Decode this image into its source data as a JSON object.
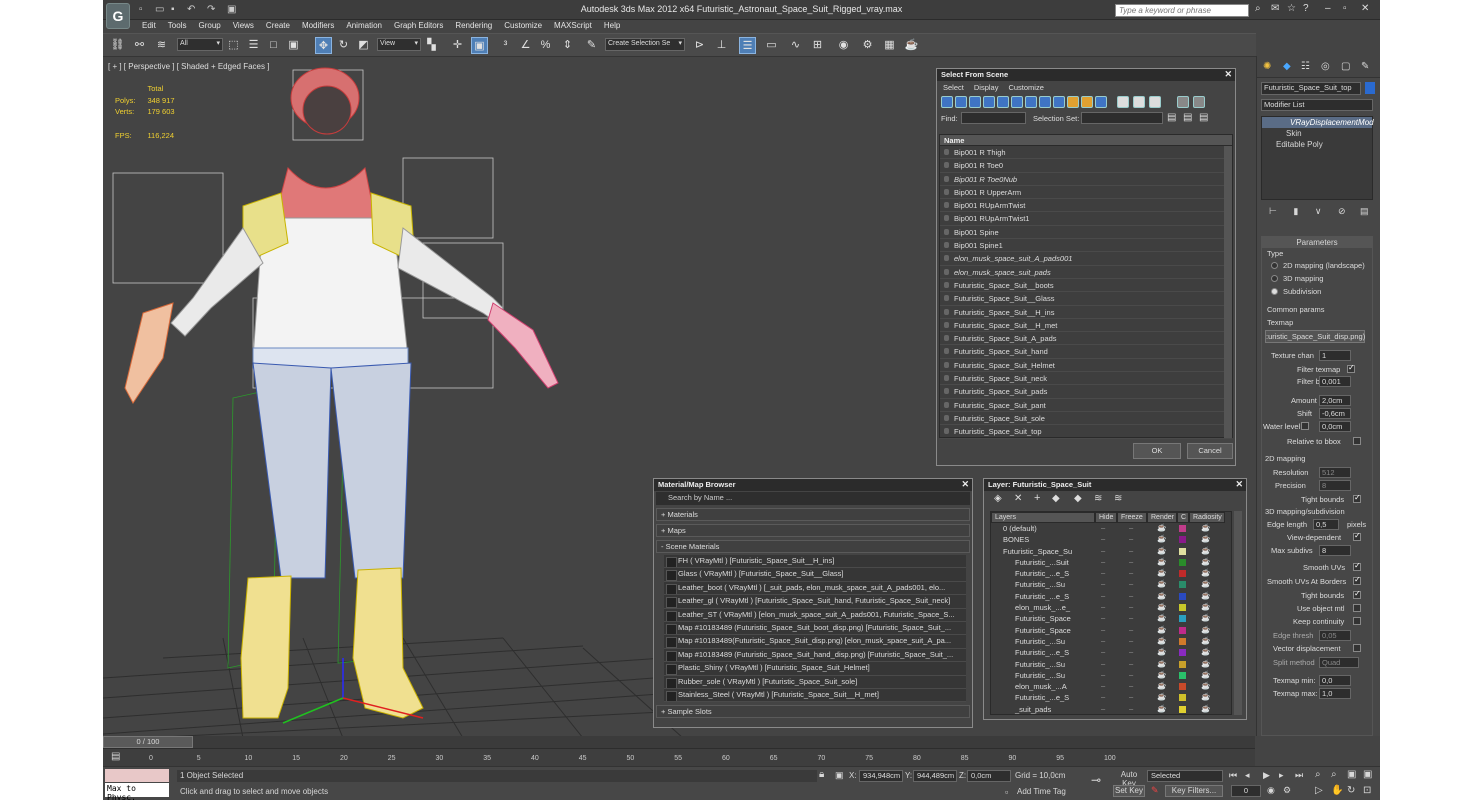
{
  "title": "Autodesk 3ds Max  2012 x64      Futuristic_Astronaut_Space_Suit_Rigged_vray.max",
  "search_placeholder": "Type a keyword or phrase",
  "menu": [
    "Edit",
    "Tools",
    "Group",
    "Views",
    "Create",
    "Modifiers",
    "Animation",
    "Graph Editors",
    "Rendering",
    "Customize",
    "MAXScript",
    "Help"
  ],
  "toolbar": {
    "filter": "All",
    "ref_coord": "View",
    "selection_set": "Create Selection Se"
  },
  "viewport": {
    "label": "[ + ] [ Perspective ] [ Shaded + Edged Faces ]",
    "stats": {
      "total_label": "Total",
      "polys_label": "Polys:",
      "polys": "348 917",
      "verts_label": "Verts:",
      "verts": "179 603",
      "fps_label": "FPS:",
      "fps": "116,224"
    }
  },
  "select_from_scene": {
    "title": "Select From Scene",
    "menu": [
      "Select",
      "Display",
      "Customize"
    ],
    "find_label": "Find:",
    "selection_set_label": "Selection Set:",
    "column": "Name",
    "rows": [
      {
        "name": "Bip001 R Thigh",
        "italic": false
      },
      {
        "name": "Bip001 R Toe0",
        "italic": false
      },
      {
        "name": "Bip001 R Toe0Nub",
        "italic": true
      },
      {
        "name": "Bip001 R UpperArm",
        "italic": false
      },
      {
        "name": "Bip001 RUpArmTwist",
        "italic": false
      },
      {
        "name": "Bip001 RUpArmTwist1",
        "italic": false
      },
      {
        "name": "Bip001 Spine",
        "italic": false
      },
      {
        "name": "Bip001 Spine1",
        "italic": false
      },
      {
        "name": "elon_musk_space_suit_A_pads001",
        "italic": true
      },
      {
        "name": "elon_musk_space_suit_pads",
        "italic": true
      },
      {
        "name": "Futuristic_Space_Suit__boots",
        "italic": false
      },
      {
        "name": "Futuristic_Space_Suit__Glass",
        "italic": false
      },
      {
        "name": "Futuristic_Space_Suit__H_ins",
        "italic": false
      },
      {
        "name": "Futuristic_Space_Suit__H_met",
        "italic": false
      },
      {
        "name": "Futuristic_Space_Suit_A_pads",
        "italic": false
      },
      {
        "name": "Futuristic_Space_Suit_hand",
        "italic": false
      },
      {
        "name": "Futuristic_Space_Suit_Helmet",
        "italic": false
      },
      {
        "name": "Futuristic_Space_Suit_neck",
        "italic": false
      },
      {
        "name": "Futuristic_Space_Suit_pads",
        "italic": false
      },
      {
        "name": "Futuristic_Space_Suit_pant",
        "italic": false
      },
      {
        "name": "Futuristic_Space_Suit_sole",
        "italic": false
      },
      {
        "name": "Futuristic_Space_Suit_top",
        "italic": false
      }
    ],
    "ok": "OK",
    "cancel": "Cancel"
  },
  "material_browser": {
    "title": "Material/Map Browser",
    "search": "Search by Name ...",
    "sections": {
      "materials": "+ Materials",
      "maps": "+ Maps",
      "scene": "- Scene Materials",
      "slots": "+ Sample Slots"
    },
    "items": [
      "FH  ( VRayMtl ) [Futuristic_Space_Suit__H_ins]",
      "Glass  ( VRayMtl ) [Futuristic_Space_Suit__Glass]",
      "Leather_boot  ( VRayMtl ) [_suit_pads, elon_musk_space_suit_A_pads001, elo...",
      "Leather_gl  ( VRayMtl ) [Futuristic_Space_Suit_hand, Futuristic_Space_Suit_neck]",
      "Leather_ST  ( VRayMtl ) [elon_musk_space_suit_A_pads001, Futuristic_Space_S...",
      "Map #10183489 (Futuristic_Space_Suit_boot_disp.png) [Futuristic_Space_Suit_...",
      "Map #10183489(Futuristic_Space_Suit_disp.png) [elon_musk_space_suit_A_pa...",
      "Map #10183489 (Futuristic_Space_Suit_hand_disp.png) [Futuristic_Space_Suit_...",
      "Plastic_Shiny  ( VRayMtl ) [Futuristic_Space_Suit_Helmet]",
      "Rubber_sole  ( VRayMtl ) [Futuristic_Space_Suit_sole]",
      "Stainless_Steel  ( VRayMtl ) [Futuristic_Space_Suit__H_met]"
    ]
  },
  "layer_panel": {
    "title": "Layer: Futuristic_Space_Suit",
    "headers": [
      "Layers",
      "Hide",
      "Freeze",
      "Render",
      "C",
      "Radiosity"
    ],
    "rows": [
      {
        "name": "0 (default)",
        "indent": 0,
        "color": "#c03c8a"
      },
      {
        "name": "BONES",
        "indent": 0,
        "color": "#8a1a8a"
      },
      {
        "name": "Futuristic_Space_Su",
        "indent": 0,
        "color": "#e0e0a0"
      },
      {
        "name": "Futuristic_...Suit",
        "indent": 1,
        "color": "#2a8c2a"
      },
      {
        "name": "Futuristic_...e_S",
        "indent": 1,
        "color": "#c02a2a"
      },
      {
        "name": "Futuristic_...Su",
        "indent": 1,
        "color": "#2a8c6a"
      },
      {
        "name": "Futuristic_...e_S",
        "indent": 1,
        "color": "#2a4ac0"
      },
      {
        "name": "elon_musk_...e_",
        "indent": 1,
        "color": "#c8c82a"
      },
      {
        "name": "Futuristic_Space",
        "indent": 1,
        "color": "#2aa0c0"
      },
      {
        "name": "Futuristic_Space",
        "indent": 1,
        "color": "#c02a8a"
      },
      {
        "name": "Futuristic_...Su",
        "indent": 1,
        "color": "#d07a2a"
      },
      {
        "name": "Futuristic_...e_S",
        "indent": 1,
        "color": "#8a2ac0"
      },
      {
        "name": "Futuristic_...Su",
        "indent": 1,
        "color": "#c8a02a"
      },
      {
        "name": "Futuristic_...Su",
        "indent": 1,
        "color": "#2ac06a"
      },
      {
        "name": "elon_musk_...A",
        "indent": 1,
        "color": "#c84a2a"
      },
      {
        "name": "Futuristic_...e_S",
        "indent": 1,
        "color": "#d0c02a"
      },
      {
        "name": "_suit_pads",
        "indent": 1,
        "color": "#e0d030"
      }
    ]
  },
  "command_panel": {
    "object_name": "Futuristic_Space_Suit_top",
    "modifier_list": "Modifier List",
    "stack": [
      "VRayDisplacementMod",
      "Skin",
      "Editable Poly"
    ],
    "params_title": "Parameters",
    "type_label": "Type",
    "type_options": [
      "2D mapping (landscape)",
      "3D mapping",
      "Subdivision"
    ],
    "common_label": "Common params",
    "texmap_label": "Texmap",
    "texmap_value": ":uristic_Space_Suit_disp.png)",
    "texture_chan_label": "Texture chan",
    "texture_chan": "1",
    "filter_texmap": "Filter texmap",
    "filter_blur_label": "Filter blur",
    "filter_blur": "0,001",
    "amount_label": "Amount",
    "amount": "2,0cm",
    "shift_label": "Shift",
    "shift": "-0,6cm",
    "water_label": "Water level",
    "water": "0,0cm",
    "relative_bbox": "Relative to bbox",
    "map2d_label": "2D mapping",
    "resolution_label": "Resolution",
    "resolution": "512",
    "precision_label": "Precision",
    "precision": "8",
    "tight_bounds": "Tight bounds",
    "map3d_label": "3D mapping/subdivision",
    "edge_length_label": "Edge length",
    "edge_length": "0,5",
    "pixels": "pixels",
    "view_dependent": "View-dependent",
    "max_subdivs_label": "Max subdivs",
    "max_subdivs": "8",
    "smooth_uvs": "Smooth UVs",
    "smooth_uvs_borders": "Smooth UVs At Borders",
    "tight_bounds2": "Tight bounds",
    "use_object_mtl": "Use object mtl",
    "keep_continuity": "Keep continuity",
    "edge_thresh_label": "Edge thresh",
    "edge_thresh": "0,05",
    "vector_disp": "Vector displacement",
    "split_label": "Split method",
    "split_value": "Quad",
    "texmap_min_label": "Texmap min:",
    "texmap_min": "0,0",
    "texmap_max_label": "Texmap max:",
    "texmap_max": "1,0"
  },
  "timeline": {
    "frame": "0 / 100",
    "ticks": [
      "0",
      "5",
      "10",
      "15",
      "20",
      "25",
      "30",
      "35",
      "40",
      "45",
      "50",
      "55",
      "60",
      "65",
      "70",
      "75",
      "80",
      "85",
      "90",
      "95",
      "100"
    ]
  },
  "status": {
    "maxscript": "Max to Physc.",
    "selected": "1 Object Selected",
    "prompt": "Click and drag to select and move objects",
    "x_label": "X:",
    "x": "934,948cm",
    "y_label": "Y:",
    "y": "944,489cm",
    "z_label": "Z:",
    "z": "0,0cm",
    "grid": "Grid = 10,0cm",
    "add_time_tag": "Add Time Tag",
    "auto_key": "Auto Key",
    "set_key": "Set Key",
    "selected_dd": "Selected",
    "key_filters": "Key Filters...",
    "frame_field": "0"
  }
}
